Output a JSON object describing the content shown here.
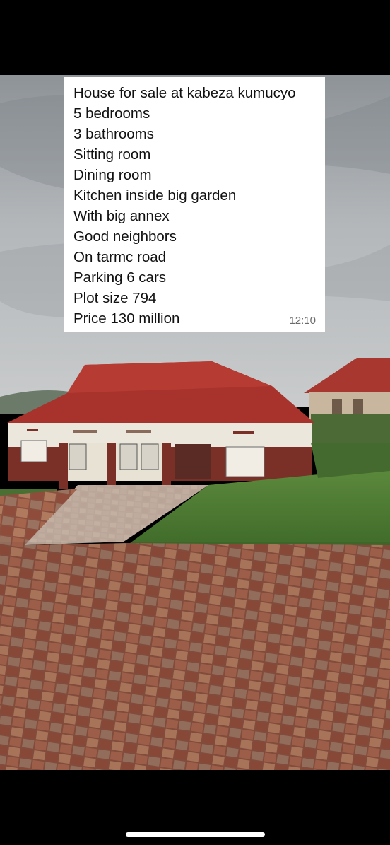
{
  "message": {
    "lines": [
      "House for sale at kabeza kumucyo",
      "5 bedrooms",
      "3 bathrooms",
      "Sitting room",
      "Dining room",
      "Kitchen inside big garden",
      "With big annex",
      "Good neighbors",
      "On tarmc road",
      "Parking 6 cars",
      "Plot size 794",
      "Price 130 million"
    ],
    "time": "12:10"
  },
  "colors": {
    "background": "#000000",
    "caption_bg": "#ffffff",
    "roof": "#a8322c",
    "wall": "#ece7dc",
    "brick": "#7a2f27",
    "grass": "#4f7d36",
    "paving": "#9b5a44",
    "sky": "#9ea4aa"
  },
  "photo": {
    "subject": "house with red roof and brick paved driveway"
  }
}
